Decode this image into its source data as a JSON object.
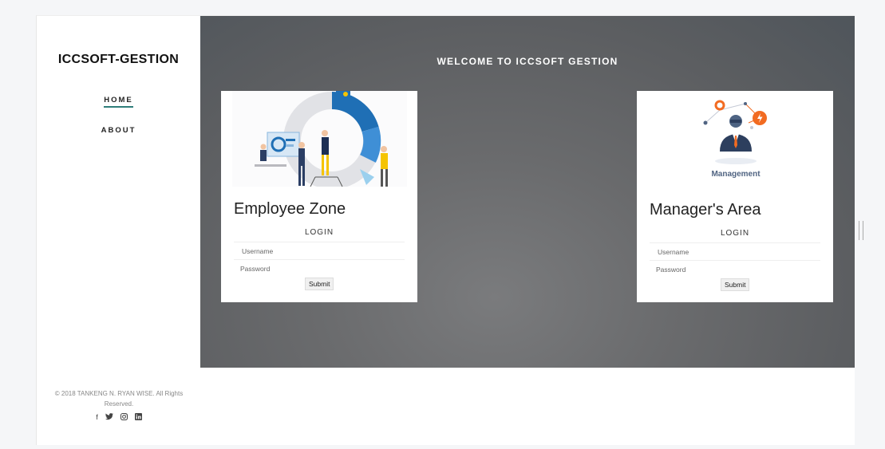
{
  "sidebar": {
    "brand": "ICCSOFT-GESTION",
    "nav": [
      {
        "label": "HOME",
        "active": true
      },
      {
        "label": "ABOUT",
        "active": false
      }
    ],
    "copyright": "© 2018 TANKENG N. RYAN WISE. All Rights Reserved.",
    "social_icons": [
      "facebook-icon",
      "twitter-icon",
      "instagram-icon",
      "linkedin-icon"
    ]
  },
  "hero": {
    "title": "WELCOME TO ICCSOFT GESTION"
  },
  "employee_card": {
    "title": "Employee Zone",
    "login_label": "LOGIN",
    "username_placeholder": "Username",
    "password_placeholder": "Password",
    "submit_label": "Submit"
  },
  "manager_card": {
    "title": "Manager's Area",
    "image_caption": "Management",
    "login_label": "LOGIN",
    "username_placeholder": "Username",
    "password_placeholder": "Password",
    "submit_label": "Submit"
  },
  "colors": {
    "accent": "#2f7d79",
    "hero_bg": "#5e6063",
    "orange": "#f26b21",
    "blue": "#1f6fb5"
  }
}
